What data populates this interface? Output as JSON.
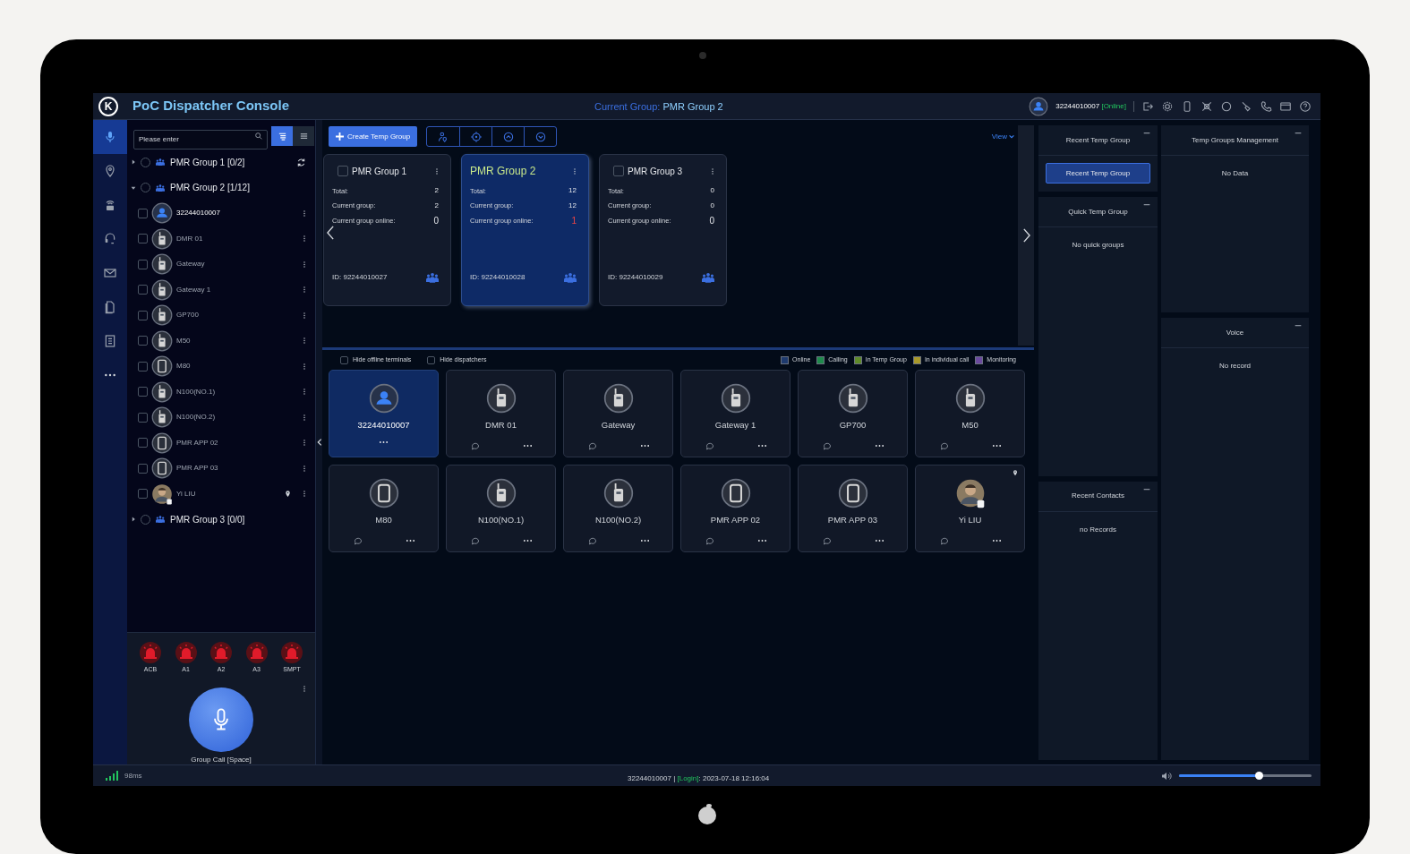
{
  "app": {
    "logo": "K",
    "title": "PoC Dispatcher Console",
    "current_group_label": "Current Group:",
    "current_group": "PMR Group 2"
  },
  "user": {
    "id": "32244010007",
    "status": "[Online]"
  },
  "rail": [
    {
      "kind": "mic",
      "selected": true
    },
    {
      "kind": "pin",
      "selected": false
    },
    {
      "kind": "sos",
      "selected": false
    },
    {
      "kind": "voice",
      "selected": false
    },
    {
      "kind": "mail",
      "selected": false
    },
    {
      "kind": "file",
      "selected": false
    },
    {
      "kind": "book",
      "selected": false
    },
    {
      "kind": "more",
      "selected": false
    }
  ],
  "search": {
    "placeholder": "Please enter"
  },
  "view_toggle": [
    {
      "kind": "tree",
      "selected": true
    },
    {
      "kind": "list",
      "selected": false
    }
  ],
  "tree": [
    {
      "label": "PMR Group 1 [0/2]",
      "expanded": false,
      "checked": false,
      "refresh": true
    },
    {
      "label": "PMR Group 2 [1/12]",
      "expanded": true,
      "checked": false,
      "refresh": false,
      "children": [
        {
          "label": "32244010007",
          "kind": "dispatcher",
          "checked": false,
          "located": false
        },
        {
          "label": "DMR 01",
          "kind": "radio",
          "checked": false,
          "located": false
        },
        {
          "label": "Gateway",
          "kind": "radio",
          "checked": false,
          "located": false
        },
        {
          "label": "Gateway 1",
          "kind": "radio",
          "checked": false,
          "located": false
        },
        {
          "label": "GP700",
          "kind": "radio",
          "checked": false,
          "located": false
        },
        {
          "label": "M50",
          "kind": "radio",
          "checked": false,
          "located": false
        },
        {
          "label": "M80",
          "kind": "phone",
          "checked": false,
          "located": false
        },
        {
          "label": "N100(NO.1)",
          "kind": "radio",
          "checked": false,
          "located": false
        },
        {
          "label": "N100(NO.2)",
          "kind": "radio",
          "checked": false,
          "located": false
        },
        {
          "label": "PMR APP 02",
          "kind": "phone",
          "checked": false,
          "located": false
        },
        {
          "label": "PMR APP 03",
          "kind": "phone",
          "checked": false,
          "located": false
        },
        {
          "label": "Yi LIU",
          "kind": "person",
          "checked": false,
          "located": true
        }
      ]
    },
    {
      "label": "PMR Group 3 [0/0]",
      "expanded": false,
      "checked": false,
      "refresh": false
    }
  ],
  "alarms": [
    {
      "label": "ACB"
    },
    {
      "label": "A1"
    },
    {
      "label": "A2"
    },
    {
      "label": "A3"
    },
    {
      "label": "SMPT"
    }
  ],
  "call_button": {
    "label": "Group Call [Space]"
  },
  "create_button": {
    "label": "Create Temp Group"
  },
  "view_menu": {
    "label": "View"
  },
  "group_cards": [
    {
      "name": "PMR Group 1",
      "selected": false,
      "checked": false,
      "id": "ID: 92244010027",
      "stats": [
        {
          "label": "Total:",
          "value": "2",
          "alert": false
        },
        {
          "label": "Current group:",
          "value": "2",
          "alert": false
        },
        {
          "label": "Current group online:",
          "value": "0",
          "alert": false
        }
      ]
    },
    {
      "name": "PMR Group 2",
      "selected": true,
      "id": "ID: 92244010028",
      "stats": [
        {
          "label": "Total:",
          "value": "12",
          "alert": false
        },
        {
          "label": "Current group:",
          "value": "12",
          "alert": false
        },
        {
          "label": "Current group online:",
          "value": "1",
          "alert": true
        }
      ]
    },
    {
      "name": "PMR Group 3",
      "selected": false,
      "checked": false,
      "id": "ID: 92244010029",
      "stats": [
        {
          "label": "Total:",
          "value": "0",
          "alert": false
        },
        {
          "label": "Current group:",
          "value": "0",
          "alert": false
        },
        {
          "label": "Current group online:",
          "value": "0",
          "alert": false
        }
      ]
    }
  ],
  "filters": [
    {
      "label": "Hide offline terminals",
      "checked": false
    },
    {
      "label": "Hide dispatchers",
      "checked": false
    }
  ],
  "legend": [
    {
      "label": "Online",
      "color": "#1e3a6e"
    },
    {
      "label": "Calling",
      "color": "#1f8a4c"
    },
    {
      "label": "In Temp Group",
      "color": "#5f8a2a"
    },
    {
      "label": "In individual call",
      "color": "#a8982a"
    },
    {
      "label": "Monitoring",
      "color": "#6b4a9e"
    }
  ],
  "terminals": [
    {
      "name": "32244010007",
      "kind": "dispatcher",
      "selected": true,
      "located": false
    },
    {
      "name": "DMR 01",
      "kind": "radio",
      "selected": false,
      "located": false
    },
    {
      "name": "Gateway",
      "kind": "radio",
      "selected": false,
      "located": false
    },
    {
      "name": "Gateway 1",
      "kind": "radio",
      "selected": false,
      "located": false
    },
    {
      "name": "GP700",
      "kind": "radio",
      "selected": false,
      "located": false
    },
    {
      "name": "M50",
      "kind": "radio",
      "selected": false,
      "located": false
    },
    {
      "name": "M80",
      "kind": "phone",
      "selected": false,
      "located": false
    },
    {
      "name": "N100(NO.1)",
      "kind": "radio",
      "selected": false,
      "located": false
    },
    {
      "name": "N100(NO.2)",
      "kind": "radio",
      "selected": false,
      "located": false
    },
    {
      "name": "PMR APP 02",
      "kind": "phone",
      "selected": false,
      "located": false
    },
    {
      "name": "PMR APP 03",
      "kind": "phone",
      "selected": false,
      "located": false
    },
    {
      "name": "Yi LIU",
      "kind": "person",
      "selected": false,
      "located": true
    }
  ],
  "panel_columns": [
    [
      {
        "title": "Recent Temp Group",
        "button": "Recent Temp Group"
      },
      {
        "title": "Quick Temp Group",
        "message": "No quick groups"
      },
      {
        "title": "Recent Contacts",
        "message": "no Records"
      }
    ],
    [
      {
        "title": "Temp Groups Management",
        "message": "No Data"
      },
      {
        "title": "Voice",
        "message": "No record"
      }
    ]
  ],
  "status_bar": {
    "latency": "98ms",
    "user": "32244010007 |",
    "login": "[Login]",
    "time": ": 2023-07-18 12:16:04",
    "volume": {
      "level": 0.6
    }
  }
}
